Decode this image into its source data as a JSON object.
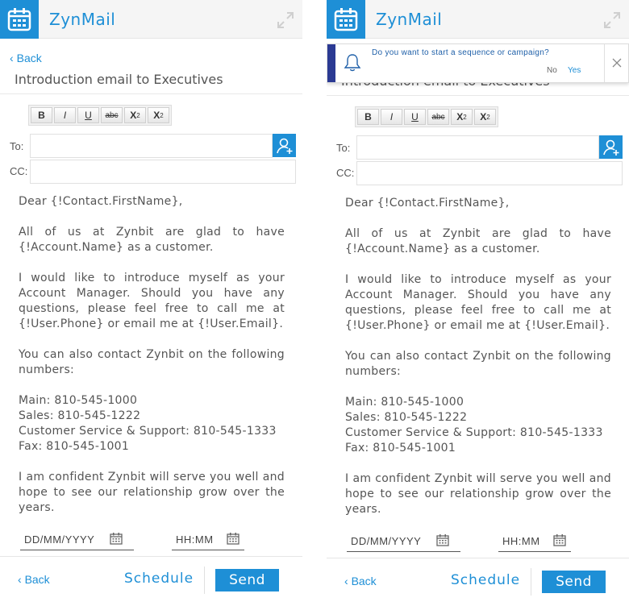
{
  "app": {
    "title": "ZynMail"
  },
  "nav": {
    "back_label": "Back"
  },
  "email": {
    "subject": "Introduction email to Executives",
    "to_label": "To:",
    "cc_label": "CC:",
    "to_value": "",
    "cc_value": "",
    "body": {
      "p1": "Dear {!Contact.FirstName},",
      "p2": "All of us at Zynbit are glad to have {!Account.Name} as a customer.",
      "p3": "I would like to introduce myself as your Account Manager. Should you have any questions, please feel free to call me at {!User.Phone} or email me at {!User.Email}.",
      "p4": "You can also contact Zynbit on the following numbers:",
      "main": "Main: 810-545-1000",
      "sales": "Sales: 810-545-1222",
      "support": "Customer Service & Support: 810-545-1333",
      "fax": "Fax: 810-545-1001",
      "p6": "I am confident Zynbit will serve you well and hope to see our relationship grow over the years."
    }
  },
  "toolbar": {
    "bold": "B",
    "italic": "I",
    "underline": "U",
    "strike": "abc",
    "subscript_base": "X",
    "subscript_mark": "2",
    "superscript_base": "X",
    "superscript_mark": "2"
  },
  "schedule": {
    "date_placeholder": "DD/MM/YYYY",
    "time_placeholder": "HH:MM"
  },
  "footer": {
    "back_label": "Back",
    "schedule_label": "Schedule",
    "send_label": "Send"
  },
  "notification": {
    "question": "Do you want to start a sequence or campaign?",
    "no_label": "No",
    "yes_label": "Yes"
  },
  "colors": {
    "accent": "#1e8fd6",
    "notification_bar": "#2b3a93"
  },
  "icons": [
    "calendar-icon",
    "expand-icon",
    "chevron-left-icon",
    "add-contact-icon",
    "bell-icon",
    "close-icon"
  ]
}
